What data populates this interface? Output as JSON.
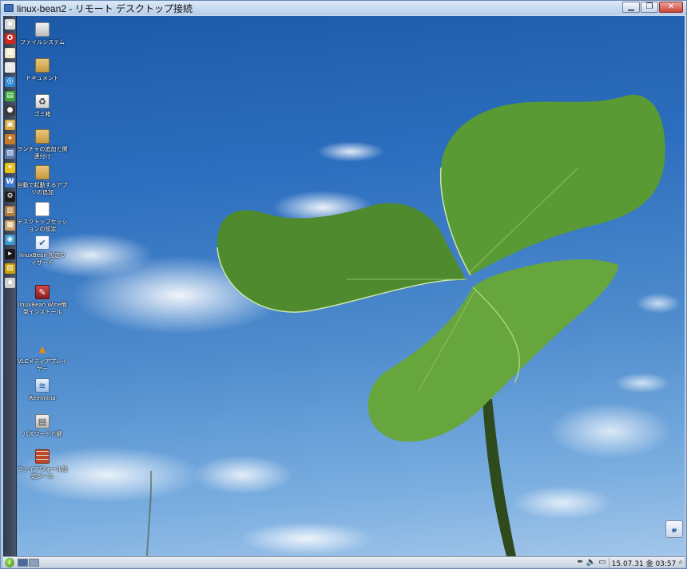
{
  "window": {
    "title": "linux-bean2 - リモート デスクトップ接続",
    "minimize_glyph": "▁",
    "restore_glyph": "❐",
    "close_glyph": "✕"
  },
  "launcher": {
    "items": [
      {
        "icon": "drive-icon",
        "glyph": "▪",
        "color": "#d9d9d9"
      },
      {
        "icon": "opera-icon",
        "glyph": "O",
        "color": "#d8221a"
      },
      {
        "icon": "notes-icon",
        "glyph": "▦",
        "color": "#f1e7c9"
      },
      {
        "icon": "pen-icon",
        "glyph": "✎",
        "color": "#e9e9e9"
      },
      {
        "icon": "network-icon",
        "glyph": "◎",
        "color": "#2f8ad8"
      },
      {
        "icon": "spreadsheet-icon",
        "glyph": "▤",
        "color": "#3aa33a"
      },
      {
        "icon": "disc-icon",
        "glyph": "●",
        "color": "#3a3a3a"
      },
      {
        "icon": "gallery-icon",
        "glyph": "▣",
        "color": "#d4a83a"
      },
      {
        "icon": "paint-icon",
        "glyph": "✦",
        "color": "#c87a2a"
      },
      {
        "icon": "image-viewer-icon",
        "glyph": "▧",
        "color": "#5a7ab0"
      },
      {
        "icon": "bird-icon",
        "glyph": "✶",
        "color": "#e8c21a"
      },
      {
        "icon": "writer-icon",
        "glyph": "W",
        "color": "#3a7ad0"
      },
      {
        "icon": "settings-icon",
        "glyph": "⚙",
        "color": "#1e1e1e"
      },
      {
        "icon": "archive-icon",
        "glyph": "▥",
        "color": "#b07a3a"
      },
      {
        "icon": "package-icon",
        "glyph": "▩",
        "color": "#c8a060"
      },
      {
        "icon": "wifi-icon",
        "glyph": "◉",
        "color": "#3a9ad0"
      },
      {
        "icon": "terminal-icon",
        "glyph": "▸",
        "color": "#1a1a1a"
      },
      {
        "icon": "monitor-icon",
        "glyph": "▨",
        "color": "#d0a000"
      },
      {
        "icon": "drive2-icon",
        "glyph": "▪",
        "color": "#cfcfcf"
      }
    ]
  },
  "desktop_icons": [
    {
      "name": "desktop-icon-filesystem",
      "icon": "drive-icon",
      "cls": "g-drive",
      "glyph": "",
      "label": "ファイルシステム"
    },
    {
      "name": "desktop-icon-documents",
      "icon": "folder-icon",
      "cls": "g-folder",
      "glyph": "",
      "label": "ドキュメント"
    },
    {
      "name": "desktop-icon-trash",
      "icon": "trash-icon",
      "cls": "g-trash",
      "glyph": "♻",
      "label": "ゴミ箱"
    },
    {
      "name": "desktop-icon-launcher-setup",
      "icon": "folder-icon",
      "cls": "g-folder",
      "glyph": "",
      "label": "ランチャの追加と関連付け"
    },
    {
      "name": "desktop-icon-autostart",
      "icon": "folder-icon",
      "cls": "g-folder",
      "glyph": "",
      "label": "自動で起動するアプリの追加"
    },
    {
      "name": "desktop-icon-session-settings",
      "icon": "blank-document-icon",
      "cls": "g-white",
      "glyph": "",
      "label": "デスクトップセッションの設定"
    },
    {
      "name": "desktop-icon-linuxbean-wizard",
      "icon": "checkbox-icon",
      "cls": "g-check",
      "glyph": "✔",
      "label": "linuxBean 設定ウィザード"
    },
    {
      "name": "desktop-icon-wine-installer",
      "icon": "wine-icon",
      "cls": "g-wine",
      "glyph": "✎",
      "label": "linuxBean Wine簡単インストール"
    },
    {
      "name": "desktop-icon-vlc",
      "icon": "vlc-cone-icon",
      "cls": "g-vlc",
      "glyph": "▲",
      "label": "VLCメディアプレイヤー"
    },
    {
      "name": "desktop-icon-remmina",
      "icon": "remmina-icon",
      "cls": "g-rem",
      "glyph": "≋",
      "label": "Remmina"
    },
    {
      "name": "desktop-icon-password-keys",
      "icon": "keyring-icon",
      "cls": "g-key",
      "glyph": "▤",
      "label": "パスワードと鍵"
    },
    {
      "name": "desktop-icon-firewall",
      "icon": "firewall-brick-icon",
      "cls": "g-fire",
      "glyph": "",
      "label": "ファイアウォール設定ツール"
    }
  ],
  "taskbar": {
    "start_glyph": "ℓ",
    "clock": "15.07.31 金 03:57",
    "tray_icons": [
      "network-pen-icon",
      "speaker-icon",
      "window-list-icon"
    ]
  },
  "corner_badge_glyph": "𝓋"
}
